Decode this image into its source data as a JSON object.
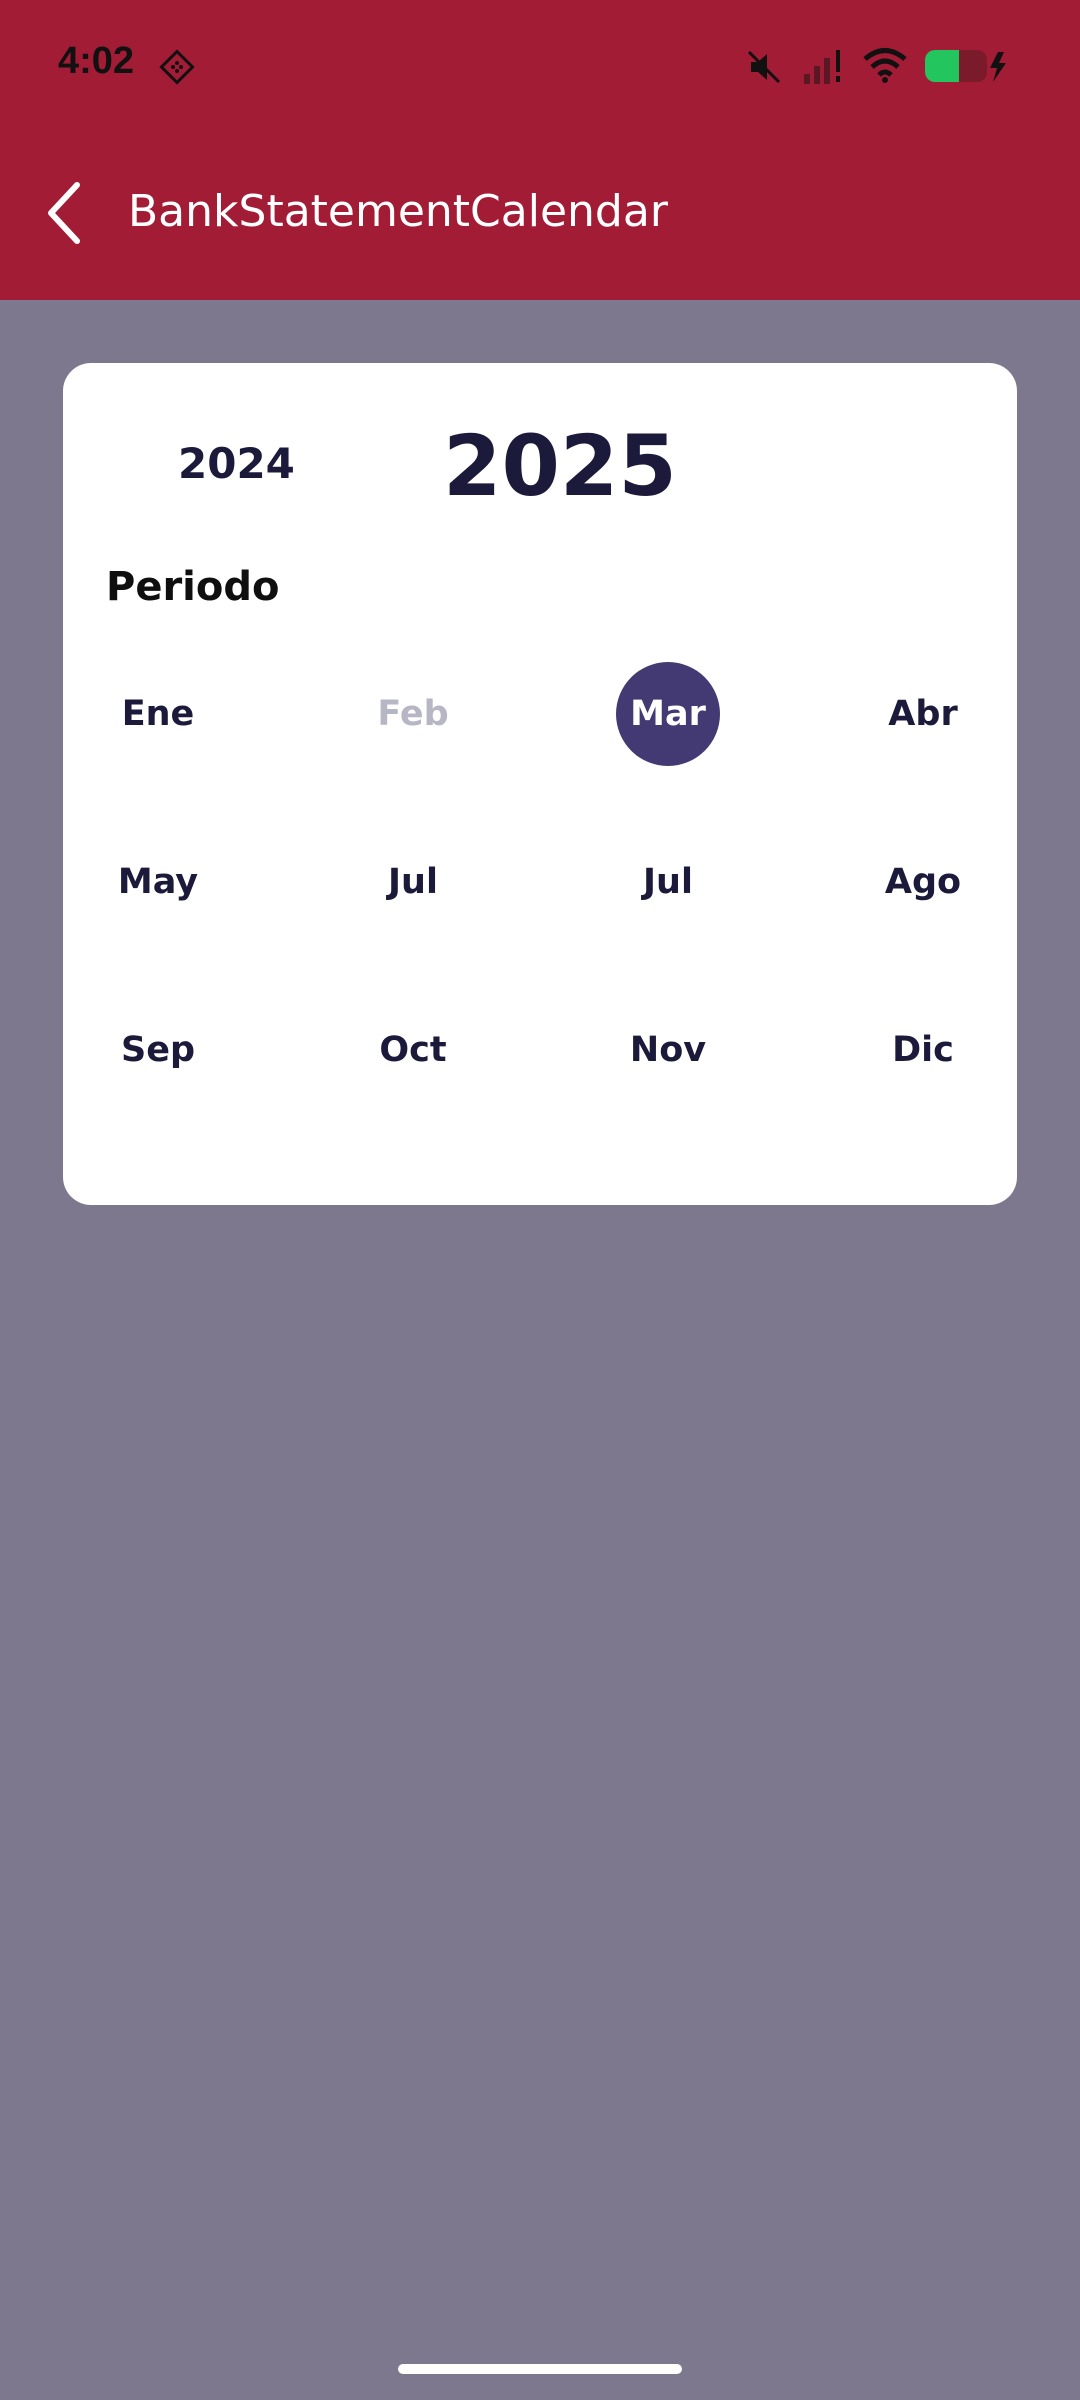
{
  "status_bar": {
    "time": "4:02",
    "icons": [
      "app-notification-icon",
      "mute-icon",
      "signal-icon",
      "wifi-icon",
      "battery-charging-icon"
    ],
    "battery_color": "#22c55e"
  },
  "appbar": {
    "title": "BankStatementCalendar",
    "back_icon": "chevron-left-icon",
    "background": "#a31c36"
  },
  "calendar": {
    "previous_year": "2024",
    "current_year": "2025",
    "period_label": "Periodo",
    "selected_color": "#433a74",
    "months": [
      {
        "label": "Ene",
        "state": "enabled"
      },
      {
        "label": "Feb",
        "state": "disabled"
      },
      {
        "label": "Mar",
        "state": "selected"
      },
      {
        "label": "Abr",
        "state": "enabled"
      },
      {
        "label": "May",
        "state": "enabled"
      },
      {
        "label": "Jul",
        "state": "enabled"
      },
      {
        "label": "Jul",
        "state": "enabled"
      },
      {
        "label": "Ago",
        "state": "enabled"
      },
      {
        "label": "Sep",
        "state": "enabled"
      },
      {
        "label": "Oct",
        "state": "enabled"
      },
      {
        "label": "Nov",
        "state": "enabled"
      },
      {
        "label": "Dic",
        "state": "enabled"
      }
    ]
  }
}
